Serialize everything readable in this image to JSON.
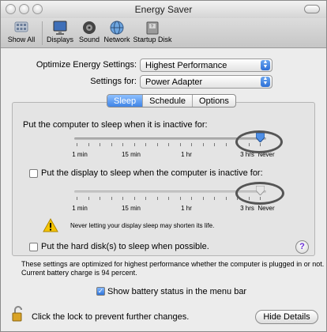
{
  "window": {
    "title": "Energy Saver"
  },
  "toolbar": {
    "items": [
      {
        "label": "Show All",
        "icon": "grid-icon"
      },
      {
        "label": "Displays",
        "icon": "display-icon"
      },
      {
        "label": "Sound",
        "icon": "speaker-icon"
      },
      {
        "label": "Network",
        "icon": "globe-icon"
      },
      {
        "label": "Startup Disk",
        "icon": "disk-icon"
      }
    ]
  },
  "settings": {
    "optimize_label": "Optimize Energy Settings:",
    "optimize_value": "Highest Performance",
    "for_label": "Settings for:",
    "for_value": "Power Adapter"
  },
  "tabs": [
    {
      "label": "Sleep",
      "selected": true
    },
    {
      "label": "Schedule"
    },
    {
      "label": "Options"
    }
  ],
  "sleep": {
    "computer_label": "Put the computer to sleep when it is inactive for:",
    "display_label": "Put the display to sleep when the computer is inactive for:",
    "ticks": [
      "1 min",
      "15 min",
      "1 hr",
      "3 hrs",
      "Never"
    ],
    "computer_value": "Never",
    "display_value": "Never",
    "warning": "Never letting your display sleep may shorten its life.",
    "hard_disk_label": "Put the hard disk(s) to sleep when possible.",
    "help": "?"
  },
  "info": {
    "line1": "These settings are optimized for highest performance whether the computer is plugged in or not.",
    "line2": "Current battery charge is 94 percent."
  },
  "battery_status_label": "Show battery status in the menu bar",
  "lock_text": "Click the lock to prevent further changes.",
  "hide_details_label": "Hide Details",
  "colors": {
    "accent": "#3f84e6",
    "ring": "#555555"
  }
}
